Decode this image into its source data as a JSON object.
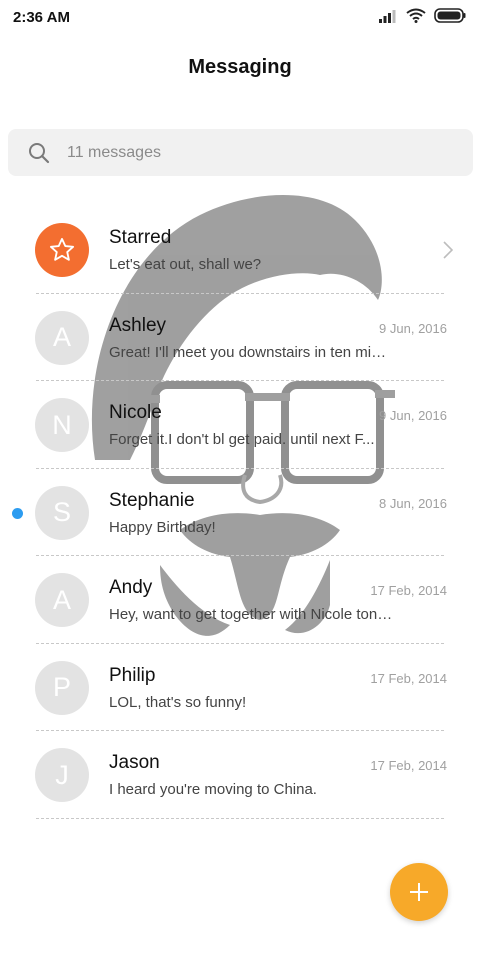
{
  "status_bar": {
    "time": "2:36 AM"
  },
  "header": {
    "title": "Messaging"
  },
  "search": {
    "text": "11 messages"
  },
  "conversations": [
    {
      "initial": "",
      "name": "Starred",
      "snippet": "Let's eat out, shall we?",
      "date": "",
      "avatar": "star-icon"
    },
    {
      "initial": "A",
      "name": "Ashley",
      "snippet": "Great! I'll meet you downstairs in ten minutes.",
      "date": "9 Jun, 2016"
    },
    {
      "initial": "N",
      "name": "Nicole",
      "snippet": "Forget it.I don't bl get paid. until next F...",
      "date": "9 Jun, 2016"
    },
    {
      "initial": "S",
      "name": "Stephanie",
      "snippet": "Happy Birthday!",
      "date": "8 Jun, 2016",
      "unread": true
    },
    {
      "initial": "A",
      "name": "Andy",
      "snippet": "Hey, want to get together with Nicole tonight?",
      "date": "17 Feb, 2014"
    },
    {
      "initial": "P",
      "name": "Philip",
      "snippet": "LOL, that's so funny!",
      "date": "17 Feb, 2014"
    },
    {
      "initial": "J",
      "name": "Jason",
      "snippet": "I heard you're moving to China.",
      "date": "17 Feb, 2014"
    }
  ],
  "colors": {
    "accent_starred": "#f36e30",
    "fab": "#f7a929",
    "unread_dot": "#2c9cf0",
    "avatar_bg": "#e3e3e3"
  },
  "icons": {
    "search": "search-icon",
    "compose": "plus-icon",
    "chevron": "chevron-right-icon",
    "watermark": "face-illustration"
  }
}
